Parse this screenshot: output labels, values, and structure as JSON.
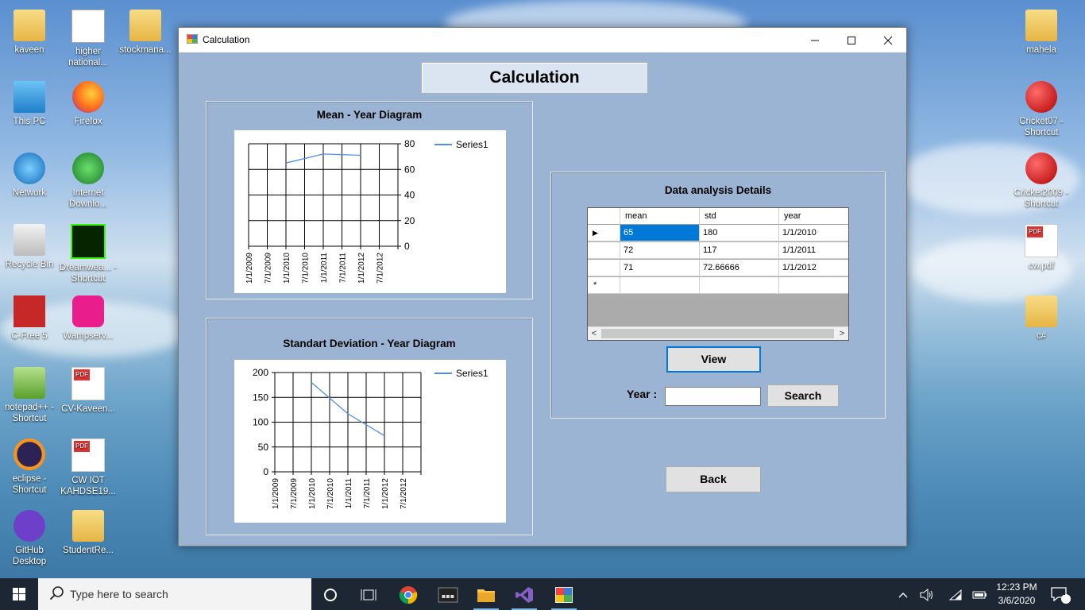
{
  "desktop": {
    "icons_left": [
      {
        "label": "kaveen",
        "icon": "user-folder-icon"
      },
      {
        "label": "higher national...",
        "icon": "document-shortcut-icon"
      },
      {
        "label": "stockmana...",
        "icon": "visual-studio-folder-icon"
      },
      {
        "label": "This PC",
        "icon": "computer-icon"
      },
      {
        "label": "Firefox",
        "icon": "firefox-icon"
      },
      {
        "label": "Network",
        "icon": "network-icon"
      },
      {
        "label": "Internet Downlo...",
        "icon": "download-manager-icon"
      },
      {
        "label": "Recycle Bin",
        "icon": "recycle-bin-icon"
      },
      {
        "label": "Dreamwea... - Shortcut",
        "icon": "dreamweaver-icon"
      },
      {
        "label": "C-Free 5",
        "icon": "cfree-icon"
      },
      {
        "label": "Wampserv...",
        "icon": "wampserver-icon"
      },
      {
        "label": "notepad++ - Shortcut",
        "icon": "notepadpp-icon"
      },
      {
        "label": "CV-Kaveen...",
        "icon": "pdf-icon"
      },
      {
        "label": "eclipse - Shortcut",
        "icon": "eclipse-icon"
      },
      {
        "label": "CW IOT KAHDSE19...",
        "icon": "pdf-icon"
      },
      {
        "label": "GitHub Desktop",
        "icon": "github-icon"
      },
      {
        "label": "StudentRe...",
        "icon": "folder-icon"
      }
    ],
    "icons_right": [
      {
        "label": "mahela",
        "icon": "folder-icon"
      },
      {
        "label": "Cricket07 - Shortcut",
        "icon": "cricket-ball-icon"
      },
      {
        "label": "Cricket2009 - Shortcut",
        "icon": "cricket-ball-icon"
      },
      {
        "label": "cw.pdf",
        "icon": "pdf-icon"
      },
      {
        "label": "c#",
        "icon": "folder-icon"
      }
    ]
  },
  "window": {
    "title": "Calculation",
    "heading": "Calculation",
    "mean_group": {
      "title": "Mean - Year Diagram"
    },
    "std_group": {
      "title": "Standart Deviation  - Year Diagram"
    },
    "details_group": {
      "title": "Data analysis Details"
    },
    "grid": {
      "columns": [
        "mean",
        "std",
        "year"
      ],
      "rows": [
        [
          "65",
          "180",
          "1/1/2010"
        ],
        [
          "72",
          "117",
          "1/1/2011"
        ],
        [
          "71",
          "72.66666",
          "1/1/2012"
        ]
      ],
      "new_row_marker": "*",
      "current_row_marker": "▶"
    },
    "view_button": "View",
    "year_label": "Year :",
    "year_input_value": "",
    "search_button": "Search",
    "back_button": "Back"
  },
  "chart_data": [
    {
      "type": "line",
      "title": "Mean - Year Diagram",
      "x": [
        "1/1/2009",
        "7/1/2009",
        "1/1/2010",
        "7/1/2010",
        "1/1/2011",
        "7/1/2011",
        "1/1/2012",
        "7/1/2012"
      ],
      "series": [
        {
          "name": "Series1",
          "x": [
            "1/1/2010",
            "1/1/2011",
            "1/1/2012"
          ],
          "values": [
            65,
            72,
            71
          ],
          "color": "#4f8fe0"
        }
      ],
      "y_ticks": [
        0,
        20,
        40,
        60,
        80
      ],
      "ylim": [
        0,
        80
      ],
      "y_axis_side": "right",
      "grid": true,
      "legend": "top-right"
    },
    {
      "type": "line",
      "title": "Standart Deviation  - Year Diagram",
      "x": [
        "1/1/2009",
        "7/1/2009",
        "1/1/2010",
        "7/1/2010",
        "1/1/2011",
        "7/1/2011",
        "1/1/2012",
        "7/1/2012"
      ],
      "series": [
        {
          "name": "Series1",
          "x": [
            "1/1/2010",
            "1/1/2011",
            "1/1/2012"
          ],
          "values": [
            180,
            117,
            72.66666
          ],
          "color": "#4f8fe0"
        }
      ],
      "y_ticks": [
        0,
        50,
        100,
        150,
        200
      ],
      "ylim": [
        0,
        200
      ],
      "y_axis_side": "left",
      "grid": true,
      "legend": "top-right"
    }
  ],
  "taskbar": {
    "search_placeholder": "Type here to search",
    "time": "12:23 PM",
    "date": "3/6/2020",
    "notification_count": "2"
  }
}
